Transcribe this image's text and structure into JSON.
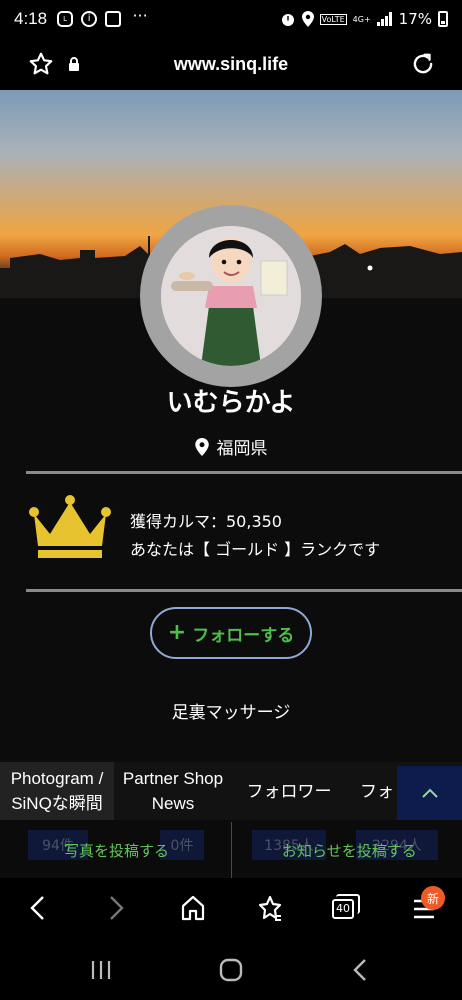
{
  "status_bar": {
    "time": "4:18",
    "left_icons": [
      "line-icon",
      "info-icon",
      "image-icon",
      "more-dots-icon"
    ],
    "right_icons": [
      "alarm-icon",
      "location-icon",
      "volte-icon",
      "4g-icon",
      "signal-icon"
    ],
    "battery": "17%"
  },
  "browser": {
    "url": "www.sinq.life",
    "tabs_count": "40",
    "badge": "新"
  },
  "profile": {
    "name": "いむらかよ",
    "location": "福岡県",
    "karma_line": "獲得カルマ：50,350",
    "rank_line": "あなたは【 ゴールド 】ランクです",
    "follow_label": "フォローする",
    "footprint_label": "足裏マッサージ"
  },
  "tabs": [
    {
      "line1": "Photogram /",
      "line2": "SiNQな瞬間"
    },
    {
      "line1": "Partner Shop",
      "line2": "News"
    },
    {
      "line1": "フォロワー",
      "line2": ""
    },
    {
      "line1": "フォ",
      "line2": ""
    }
  ],
  "counts": {
    "photos": "94件",
    "news": "0件",
    "followers": "1385人",
    "following": "2294人"
  },
  "actions": {
    "post_photo": "写真を投稿する",
    "post_news": "お知らせを投稿する"
  },
  "colors": {
    "follow_green": "#4fbd4c",
    "follow_border": "#8fa8d6",
    "crown_gold": "#e8c330",
    "badge_orange": "#f05a26",
    "scroll_top_bg": "#0d1b4d"
  }
}
